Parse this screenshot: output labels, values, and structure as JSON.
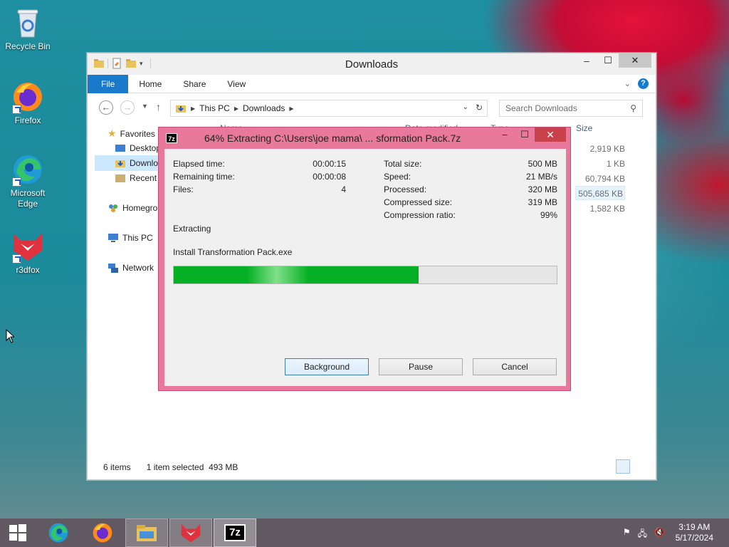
{
  "desktop": {
    "icons": [
      {
        "label": "Recycle Bin",
        "icon": "recycle-bin-icon"
      },
      {
        "label": "Firefox",
        "icon": "firefox-icon"
      },
      {
        "label": "Microsoft Edge",
        "icon": "edge-icon"
      },
      {
        "label": "r3dfox",
        "icon": "r3dfox-icon"
      }
    ]
  },
  "explorer": {
    "title": "Downloads",
    "ribbon_tabs": [
      "File",
      "Home",
      "Share",
      "View"
    ],
    "address": {
      "crumbs": [
        "This PC",
        "Downloads"
      ]
    },
    "search_placeholder": "Search Downloads",
    "nav": {
      "favorites": "Favorites",
      "desktop": "Desktop",
      "downloads": "Downlo",
      "recent": "Recent p",
      "homegroup": "Homegro",
      "this_pc": "This PC",
      "network": "Network"
    },
    "columns": {
      "name": "Name",
      "date_modified": "Date modified",
      "type": "Type",
      "size": "Size"
    },
    "sizes": [
      "2,919 KB",
      "1 KB",
      "60,794 KB",
      "505,685 KB",
      "1,582 KB"
    ],
    "status": {
      "items": "6 items",
      "selected": "1 item selected  493 MB"
    }
  },
  "zip_dialog": {
    "title": "64% Extracting C:\\Users\\joe mama\\ ... sformation Pack.7z",
    "app_icon": "7z",
    "left_stats": [
      {
        "label": "Elapsed time:",
        "value": "00:00:15"
      },
      {
        "label": "Remaining time:",
        "value": "00:00:08"
      },
      {
        "label": "Files:",
        "value": "4"
      }
    ],
    "right_stats": [
      {
        "label": "Total size:",
        "value": "500 MB"
      },
      {
        "label": "Speed:",
        "value": "21 MB/s"
      },
      {
        "label": "Processed:",
        "value": "320 MB"
      },
      {
        "label": "Compressed size:",
        "value": "319 MB"
      },
      {
        "label": "Compression ratio:",
        "value": "99%"
      }
    ],
    "operation": "Extracting",
    "current_file": "Install Transformation Pack.exe",
    "progress_fraction": 0.64,
    "buttons": {
      "background": "Background",
      "pause": "Pause",
      "cancel": "Cancel"
    }
  },
  "taskbar": {
    "clock_time": "3:19 AM",
    "clock_date": "5/17/2024",
    "pinned": [
      "start-icon",
      "edge-icon",
      "firefox-icon",
      "file-explorer-icon",
      "r3dfox-icon",
      "7zip-icon"
    ]
  },
  "colors": {
    "accent": "#1979ca",
    "progress": "#06b025",
    "dialog_frame": "#e8789c"
  }
}
